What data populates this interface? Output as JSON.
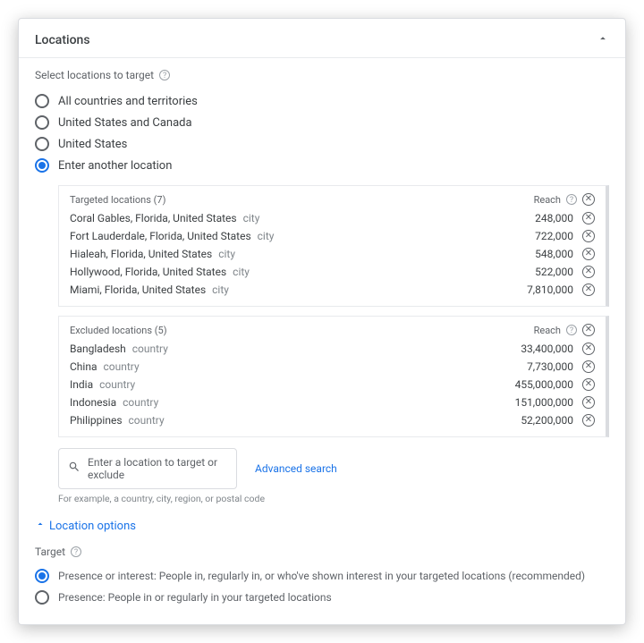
{
  "header": {
    "title": "Locations"
  },
  "subtext": "Select locations to target",
  "radios": [
    {
      "label": "All countries and territories",
      "selected": false
    },
    {
      "label": "United States and Canada",
      "selected": false
    },
    {
      "label": "United States",
      "selected": false
    },
    {
      "label": "Enter another location",
      "selected": true
    }
  ],
  "targeted": {
    "heading": "Targeted locations (7)",
    "reach_label": "Reach",
    "rows": [
      {
        "name": "Coral Gables, Florida, United States",
        "type": "city",
        "reach": "248,000"
      },
      {
        "name": "Fort Lauderdale, Florida, United States",
        "type": "city",
        "reach": "722,000"
      },
      {
        "name": "Hialeah, Florida, United States",
        "type": "city",
        "reach": "548,000"
      },
      {
        "name": "Hollywood, Florida, United States",
        "type": "city",
        "reach": "522,000"
      },
      {
        "name": "Miami, Florida, United States",
        "type": "city",
        "reach": "7,810,000"
      }
    ]
  },
  "excluded": {
    "heading": "Excluded locations (5)",
    "reach_label": "Reach",
    "rows": [
      {
        "name": "Bangladesh",
        "type": "country",
        "reach": "33,400,000"
      },
      {
        "name": "China",
        "type": "country",
        "reach": "7,730,000"
      },
      {
        "name": "India",
        "type": "country",
        "reach": "455,000,000"
      },
      {
        "name": "Indonesia",
        "type": "country",
        "reach": "151,000,000"
      },
      {
        "name": "Philippines",
        "type": "country",
        "reach": "52,200,000"
      }
    ]
  },
  "search": {
    "placeholder": "Enter a location to target or exclude",
    "advanced": "Advanced search",
    "hint": "For example, a country, city, region, or postal code"
  },
  "location_options_label": "Location options",
  "target_section": {
    "label": "Target",
    "options": [
      {
        "label": "Presence or interest: People in, regularly in, or who've shown interest in your targeted locations (recommended)",
        "selected": true
      },
      {
        "label": "Presence: People in or regularly in your targeted locations",
        "selected": false
      }
    ]
  }
}
